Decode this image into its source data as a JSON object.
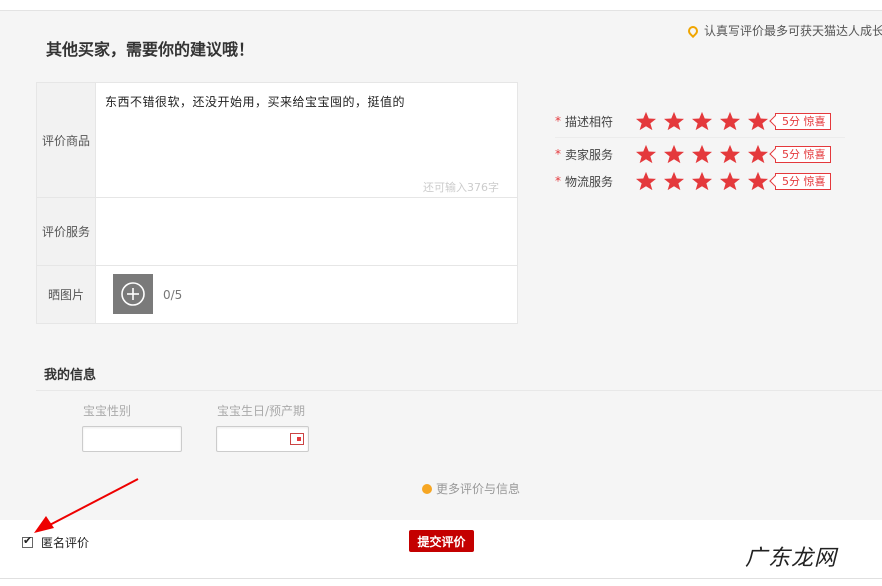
{
  "header": {
    "title": "其他买家，需要你的建议哦！",
    "tip": "认真写评价最多可获天猫达人成长值"
  },
  "form": {
    "product_label": "评价商品",
    "review_text": "东西不错很软，还没开始用，买来给宝宝囤的，挺值的",
    "remaining_text": "还可输入376字",
    "service_label": "评价服务",
    "photo_label": "晒图片",
    "photo_count": "0/5"
  },
  "ratings": [
    {
      "label": "描述相符",
      "required_mark": "*",
      "stars": 5,
      "badge": "5分 惊喜"
    },
    {
      "label": "卖家服务",
      "required_mark": "*",
      "stars": 5,
      "badge": "5分 惊喜"
    },
    {
      "label": "物流服务",
      "required_mark": "*",
      "stars": 5,
      "badge": "5分 惊喜"
    }
  ],
  "my_info": {
    "title": "我的信息",
    "gender_label": "宝宝性别",
    "birthday_label": "宝宝生日/预产期",
    "more_info": "更多评价与信息"
  },
  "footer": {
    "anonymous_label": "匿名评价",
    "anonymous_checked": true,
    "submit_label": "提交评价"
  },
  "colors": {
    "accent": "#c40000",
    "star": "#e4393c",
    "tip_icon": "#f0a500"
  },
  "watermark": "广东龙网"
}
